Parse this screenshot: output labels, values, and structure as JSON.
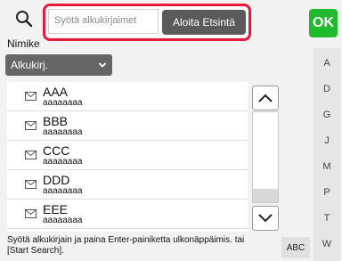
{
  "header": {
    "name_label": "Nimike",
    "search_placeholder": "Syötä alkukirjaimet",
    "start_search_label": "Aloita Etsintä",
    "ok_label": "OK"
  },
  "filter": {
    "selected": "Alkukirj."
  },
  "list": {
    "items": [
      {
        "name": "AAA",
        "sub": "aaaaaaaa"
      },
      {
        "name": "BBB",
        "sub": "aaaaaaaa"
      },
      {
        "name": "CCC",
        "sub": "aaaaaaaa"
      },
      {
        "name": "DDD",
        "sub": "aaaaaaaa"
      },
      {
        "name": "EEE",
        "sub": "aaaaaaaa"
      }
    ]
  },
  "index": {
    "letters": [
      "A",
      "D",
      "G",
      "J",
      "M",
      "P",
      "T",
      "W"
    ]
  },
  "footer": {
    "hint": "Syötä alkukirjain ja paina Enter-painiketta ulkonäppäimis. tai [Start Search].",
    "abc_label": "ABC"
  },
  "colors": {
    "highlight": "#e8193c",
    "ok": "#1fba2d",
    "button_dark": "#5a5a5a"
  }
}
